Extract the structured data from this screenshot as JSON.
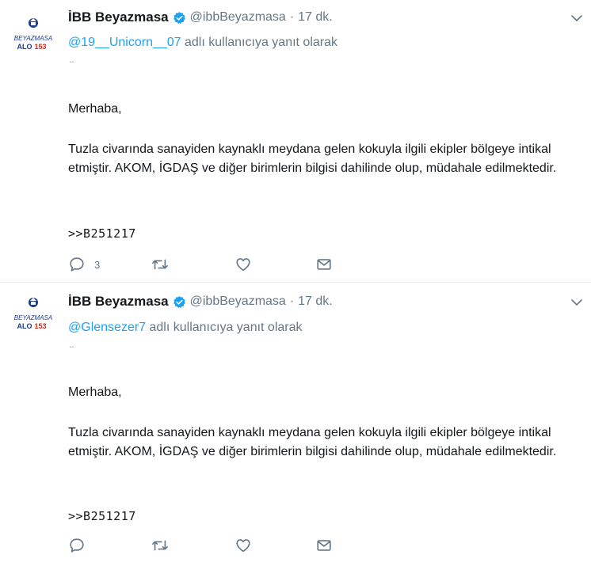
{
  "colors": {
    "link": "#1da1f2",
    "muted": "#657786",
    "text": "#14171a",
    "divider": "#e6ecf0",
    "logo_blue": "#1a3a8a",
    "logo_red": "#d9261c"
  },
  "tweets": [
    {
      "avatar": {
        "line1": "BEYAZMASA",
        "line2_prefix": "ALO",
        "line2_number": "153"
      },
      "name": "İBB Beyazmasa",
      "verified_icon": "verified-badge-icon",
      "handle": "@ibbBeyazmasa",
      "dot": "·",
      "time": "17 dk.",
      "caret_icon": "chevron-down-icon",
      "reply_user": "@19__Unicorn__07",
      "reply_suffix": " adlı kullanıcıya yanıt olarak",
      "tiny_mark": "\"\"",
      "greeting": "Merhaba,",
      "paragraph": "Tuzla civarında sanayiden kaynaklı meydana gelen kokuyla ilgili ekipler bölgeye intikal etmiştir. AKOM, İGDAŞ ve diğer birimlerin bilgisi dahilinde olup, müdahale edilmektedir.",
      "reference": ">>B251217",
      "actions": {
        "reply_count": "3",
        "reply_icon": "reply-icon",
        "retweet_icon": "retweet-icon",
        "like_icon": "like-icon",
        "dm_icon": "direct-message-icon"
      }
    },
    {
      "avatar": {
        "line1": "BEYAZMASA",
        "line2_prefix": "ALO",
        "line2_number": "153"
      },
      "name": "İBB Beyazmasa",
      "verified_icon": "verified-badge-icon",
      "handle": "@ibbBeyazmasa",
      "dot": "·",
      "time": "17 dk.",
      "caret_icon": "chevron-down-icon",
      "reply_user": "@Glensezer7",
      "reply_suffix": " adlı kullanıcıya yanıt olarak",
      "tiny_mark": "\"\"",
      "greeting": "Merhaba,",
      "paragraph": "Tuzla civarında sanayiden kaynaklı meydana gelen kokuyla ilgili ekipler bölgeye intikal etmiştir. AKOM, İGDAŞ ve diğer birimlerin bilgisi dahilinde olup, müdahale edilmektedir.",
      "reference": ">>B251217",
      "actions": {
        "reply_count": "",
        "reply_icon": "reply-icon",
        "retweet_icon": "retweet-icon",
        "like_icon": "like-icon",
        "dm_icon": "direct-message-icon"
      }
    }
  ]
}
